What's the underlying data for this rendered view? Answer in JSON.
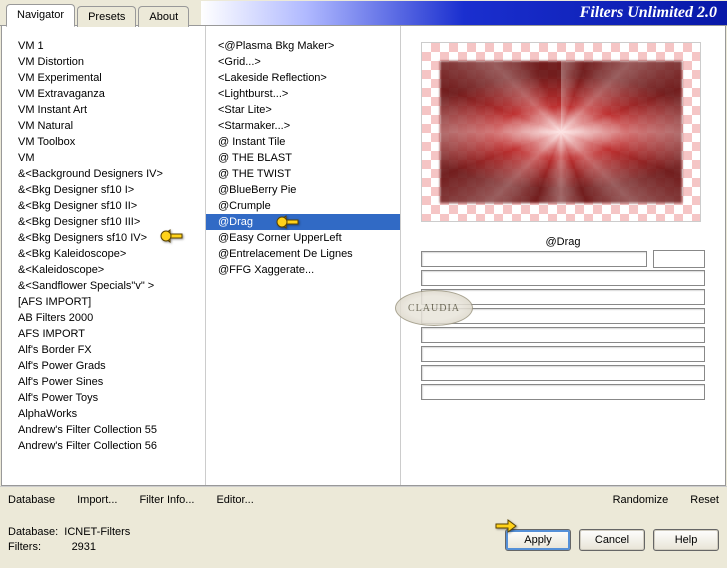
{
  "app_title": "Filters Unlimited 2.0",
  "tabs": [
    {
      "label": "Navigator",
      "active": true
    },
    {
      "label": "Presets",
      "active": false
    },
    {
      "label": "About",
      "active": false
    }
  ],
  "categories": [
    "VM 1",
    "VM Distortion",
    "VM Experimental",
    "VM Extravaganza",
    "VM Instant Art",
    "VM Natural",
    "VM Toolbox",
    "VM",
    "&<Background Designers IV>",
    "&<Bkg Designer sf10 I>",
    "&<Bkg Designer sf10 II>",
    "&<Bkg Designer sf10 III>",
    "&<Bkg Designers sf10 IV>",
    "&<Bkg Kaleidoscope>",
    "&<Kaleidoscope>",
    "&<Sandflower Specials\"v\" >",
    "[AFS IMPORT]",
    "AB Filters 2000",
    "AFS IMPORT",
    "Alf's Border FX",
    "Alf's Power Grads",
    "Alf's Power Sines",
    "Alf's Power Toys",
    "AlphaWorks",
    "Andrew's Filter Collection 55",
    "Andrew's Filter Collection 56"
  ],
  "selected_category_index": 12,
  "filters": [
    "<@Plasma Bkg Maker>",
    "<Grid...>",
    "<Lakeside Reflection>",
    "<Lightburst...>",
    "<Star Lite>",
    "<Starmaker...>",
    "@ Instant Tile",
    "@ THE BLAST",
    "@ THE TWIST",
    "@BlueBerry Pie",
    "@Crumple",
    "@Drag",
    "@Easy Corner UpperLeft",
    "@Entrelacement De Lignes",
    "@FFG Xaggerate..."
  ],
  "selected_filter_index": 11,
  "param_label": "@Drag",
  "param_value": "",
  "bottom_buttons": {
    "database": "Database",
    "import": "Import...",
    "filter_info": "Filter Info...",
    "editor": "Editor...",
    "randomize": "Randomize",
    "reset": "Reset"
  },
  "footer": {
    "database_label": "Database:",
    "database_value": "ICNET-Filters",
    "filters_label": "Filters:",
    "filters_value": "2931",
    "apply": "Apply",
    "cancel": "Cancel",
    "help": "Help"
  },
  "watermark": "CLAUDIA"
}
